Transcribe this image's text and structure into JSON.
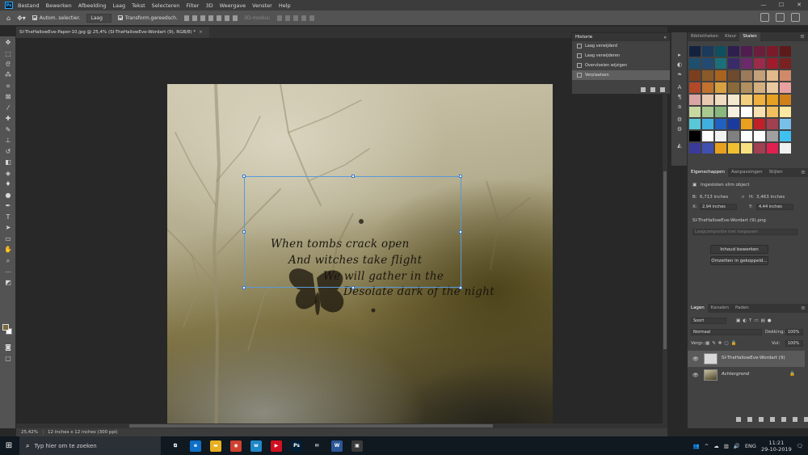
{
  "app": {
    "logo": "Ps"
  },
  "menu": [
    "Bestand",
    "Bewerken",
    "Afbeelding",
    "Laag",
    "Tekst",
    "Selecteren",
    "Filter",
    "3D",
    "Weergave",
    "Venster",
    "Help"
  ],
  "window_controls": [
    "—",
    "☐",
    "✕"
  ],
  "options": {
    "auto_select_label": "Autom. selectier.",
    "layer_select": "Laag",
    "transform_label": "Transform.gereedsch.",
    "mode_3d": "3D-modus:"
  },
  "document_tab": {
    "title": "SI-TheHallowEve-Paper-10.jpg @ 25,4% (SI-TheHallowEve-Wordart (9), RGB/8) *",
    "close": "×"
  },
  "poem": [
    "When tombs crack open",
    "And witches take flight",
    "We will gather in the",
    "Desolate dark of the night"
  ],
  "status": {
    "zoom": "25,42%",
    "doc_info": "12 inches x 12 inches (300 ppi)"
  },
  "historie": {
    "title": "Historie",
    "collapse": "»",
    "menu": "≡",
    "items": [
      {
        "label": "Laag verwijderd",
        "active": false
      },
      {
        "label": "Laag verwijderen",
        "active": false
      },
      {
        "label": "Overvloeien wijzigen",
        "active": false
      },
      {
        "label": "Verplaatsen",
        "active": true
      }
    ]
  },
  "swatches_panel": {
    "tabs": [
      "Bibliotheken",
      "Kleur",
      "Stalen"
    ],
    "active_tab": "Stalen",
    "colors": [
      "#13233f",
      "#1b3a5c",
      "#0f4f5f",
      "#2f1f4f",
      "#4f1e4f",
      "#6b1e3c",
      "#7b1a2a",
      "#5c1a1a",
      "#1e4f6e",
      "#234a72",
      "#1b6f7a",
      "#3a2b6b",
      "#6b2b6b",
      "#9b2b4b",
      "#a01c2c",
      "#7a2222",
      "#7b3f1f",
      "#8a5a2a",
      "#a8631e",
      "#6e4a2e",
      "#9a7a5a",
      "#c2a07a",
      "#e2b98a",
      "#d08a6a",
      "#b24a2a",
      "#c0722e",
      "#d8a040",
      "#8a6a3a",
      "#b09060",
      "#d4b080",
      "#e8c9a0",
      "#e8a0a0",
      "#d9a5a5",
      "#e8c8b0",
      "#f0dcc0",
      "#f5e8d0",
      "#f2d080",
      "#f0b040",
      "#e8a020",
      "#d08018",
      "#c8d8a0",
      "#a8c890",
      "#88b880",
      "#f5f0e0",
      "#ffffff",
      "#f8e0b0",
      "#f0c060",
      "#fce8a0",
      "#58c8d8",
      "#40b0e0",
      "#2060c0",
      "#1a3aa0",
      "#e8a020",
      "#c02028",
      "#a04050",
      "#78c0e8",
      "#000000",
      "#ffffff",
      "#f2f2f2",
      "#808080",
      "#ffffff",
      "#ffffff",
      "#a0a0a0",
      "#40c0f0",
      "#3a3a9a",
      "#4050b0",
      "#e8a020",
      "#f0c030",
      "#f8e080",
      "#a04050",
      "#e02050",
      "#f0f0f0"
    ]
  },
  "properties": {
    "tabs": [
      "Eigenschappen",
      "Aanpassingen",
      "Stijlen"
    ],
    "active_tab": "Eigenschappen",
    "object_type": "Ingesloten slim object",
    "b_label": "B:",
    "b_value": "6,713 inches",
    "h_label": "H:",
    "h_value": "3,463 inches",
    "x_label": "X:",
    "x_value": "2,94 inches",
    "y_label": "Y:",
    "y_value": "4,44 inches",
    "filename": "SI-TheHallowEve-Wordart (9).png",
    "layer_comp": "Laagcompositie met toepassen",
    "btn_edit": "Inhoud bewerken",
    "btn_convert": "Omzetten in gekoppeld..."
  },
  "layers": {
    "tabs": [
      "Lagen",
      "Kanalen",
      "Paden"
    ],
    "active_tab": "Lagen",
    "filter_select": "Soort",
    "blend_mode": "Normaal",
    "opacity_label": "Dekking:",
    "opacity_value": "100%",
    "lock_label": "Vergr.:",
    "fill_label": "Vul:",
    "fill_value": "100%",
    "items": [
      {
        "name": "SI-TheHallowEve-Wordart (9)",
        "active": true
      },
      {
        "name": "Achtergrond",
        "active": false
      }
    ]
  },
  "taskbar": {
    "search_placeholder": "Typ hier om te zoeken",
    "language": "ENG",
    "time": "11:21",
    "date": "29-10-2019",
    "apps": [
      {
        "name": "task-view",
        "glyph": "⧉",
        "color": "#101820"
      },
      {
        "name": "edge",
        "glyph": "e",
        "color": "#0f6fc6"
      },
      {
        "name": "file-explorer",
        "glyph": "▬",
        "color": "#e8b020"
      },
      {
        "name": "chrome",
        "glyph": "◉",
        "color": "#d04030"
      },
      {
        "name": "blog-app",
        "glyph": "w",
        "color": "#1e88c8"
      },
      {
        "name": "media-app",
        "glyph": "▶",
        "color": "#d01020"
      },
      {
        "name": "photoshop",
        "glyph": "Ps",
        "color": "#001e36"
      },
      {
        "name": "mail",
        "glyph": "✉",
        "color": "#101820"
      },
      {
        "name": "word",
        "glyph": "W",
        "color": "#2b5797"
      },
      {
        "name": "app-10",
        "glyph": "▣",
        "color": "#3a3a3a"
      }
    ]
  }
}
